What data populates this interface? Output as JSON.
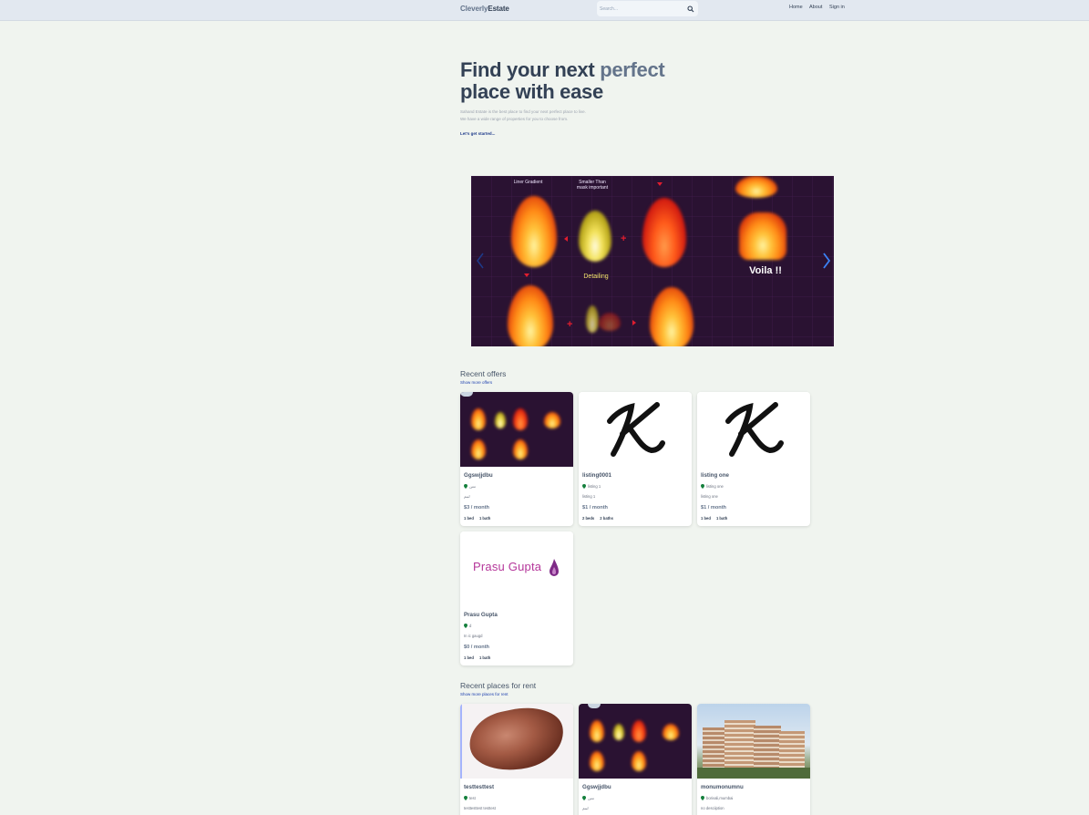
{
  "header": {
    "logo_part1": "Cleverly",
    "logo_part2": "Estate",
    "search_placeholder": "Search...",
    "nav": [
      "Home",
      "About",
      "Sign in"
    ]
  },
  "hero": {
    "title_line1_pre": "Find your next ",
    "title_line1_highlight": "perfect",
    "title_line2": "place with ease",
    "subtitle_line1": "Sahand Estate is the best place to find your next perfect place to live.",
    "subtitle_line2": "We have a wide range of properties for you to choose from.",
    "cta": "Let's get started..."
  },
  "slider": {
    "labels": [
      "Liner Gradient",
      "Smaller Than",
      "mask important",
      "Detailing",
      "Voila !!"
    ],
    "prev_icon": "chevron-left-icon",
    "next_icon": "chevron-right-icon"
  },
  "offers": {
    "title": "Recent offers",
    "link": "Show more offers",
    "cards": [
      {
        "name": "Ggswjjdbu",
        "address": "تتتن",
        "description": "لبنم",
        "price": "$3 / month",
        "beds": "1 bed",
        "baths": "1 bath",
        "image": "fire-slides"
      },
      {
        "name": "listing0001",
        "address": "listing 1",
        "description": "listing 1",
        "price": "$1 / month",
        "beds": "2 beds",
        "baths": "2 baths",
        "image": "k-logo"
      },
      {
        "name": "listing one",
        "address": "listing one",
        "description": "listing one",
        "price": "$1 / month",
        "beds": "1 bed",
        "baths": "1 bath",
        "image": "k-logo"
      },
      {
        "name": "Prasu Gupta",
        "address": "d",
        "description": "In ic gaugd",
        "price": "$0 / month",
        "beds": "1 bed",
        "baths": "1 bath",
        "image": "prasu-logo",
        "image_text": "Prasu Gupta"
      }
    ]
  },
  "rent": {
    "title": "Recent places for rent",
    "link": "Show more places for rent",
    "cards": [
      {
        "name": "testtesttest",
        "address": "test",
        "description": "testtesttest testtest",
        "image": "meat-photo"
      },
      {
        "name": "Ggswjjdbu",
        "address": "تتتن",
        "description": "لبنم",
        "image": "fire-slides"
      },
      {
        "name": "monumonumnu",
        "address": "borivali,mumbai",
        "description": "no desciiption",
        "image": "apartment-photo"
      }
    ]
  },
  "colors": {
    "background": "#f0f4ef",
    "header": "#e2e8f0",
    "text_dark": "#334155",
    "text_highlight": "#64748b",
    "link": "#1e40af",
    "pin_green": "#15803d"
  }
}
